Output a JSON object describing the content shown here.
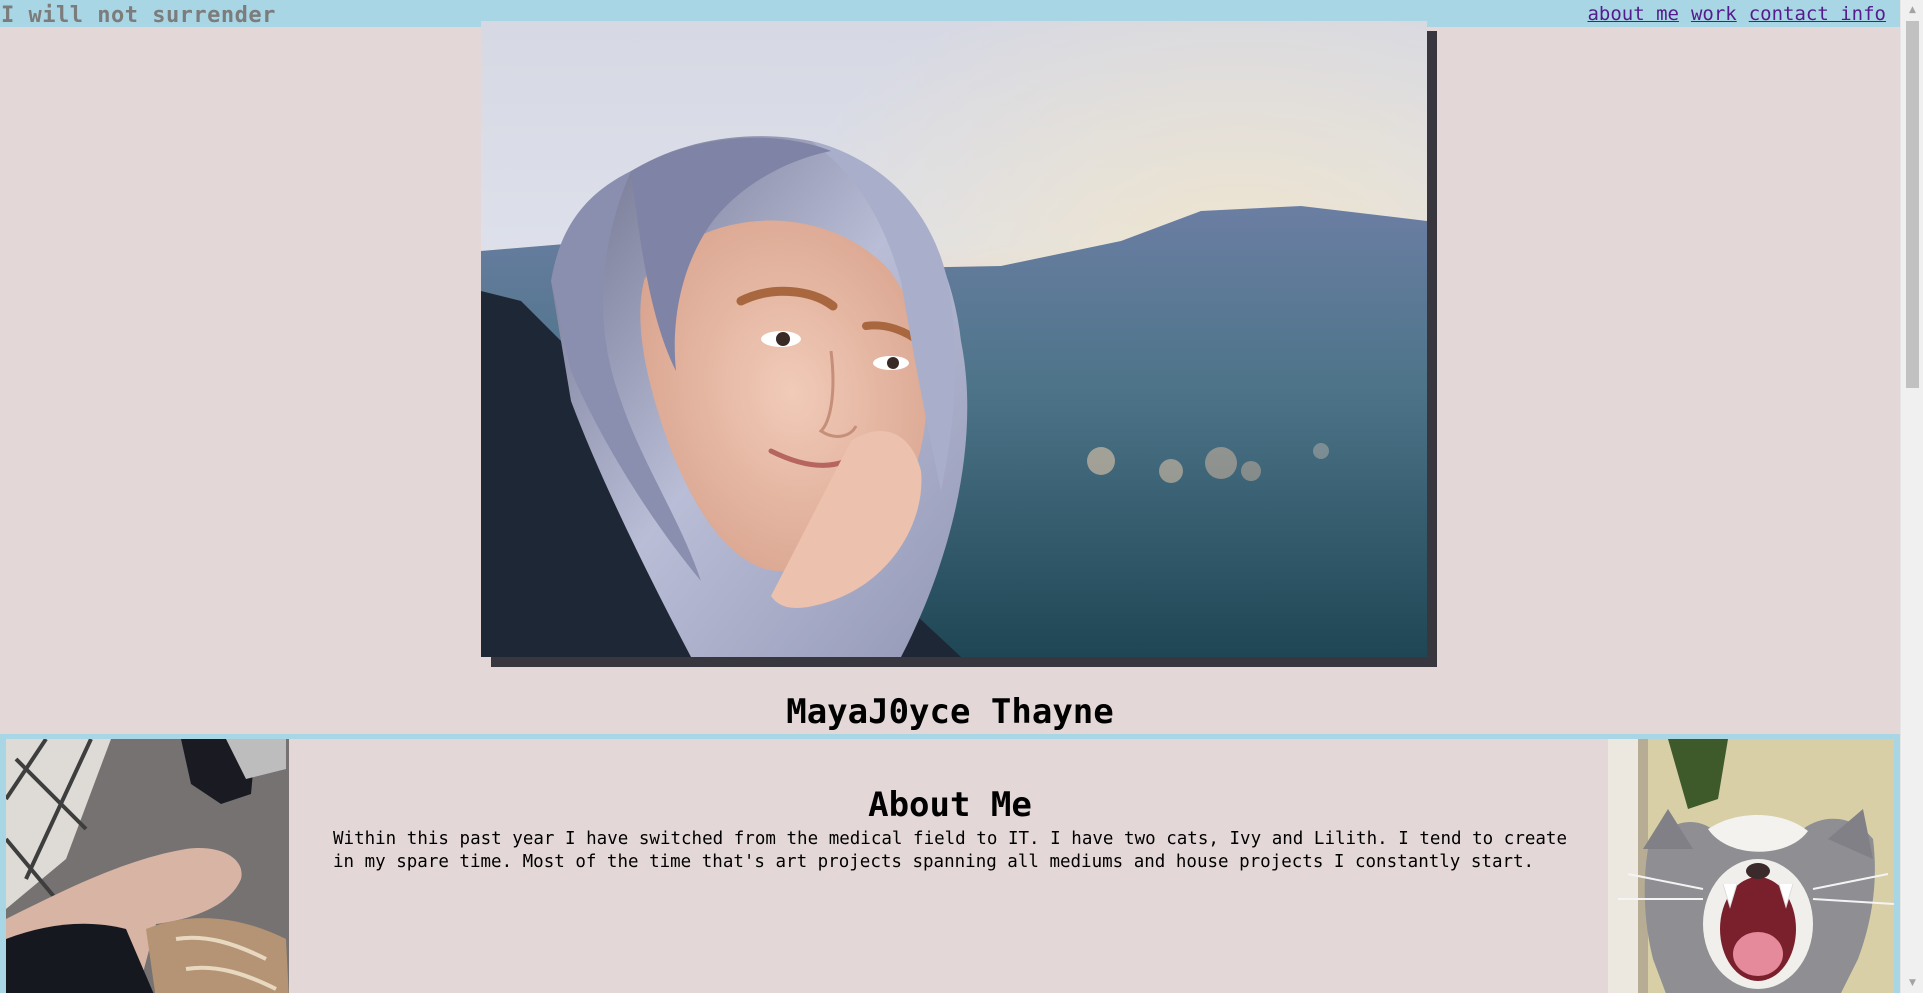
{
  "header": {
    "site_title": "I will not surrender",
    "nav": [
      {
        "label": "about me"
      },
      {
        "label": "work"
      },
      {
        "label": "contact info"
      }
    ]
  },
  "hero": {
    "name": "MayaJ0yce Thayne"
  },
  "about": {
    "title": "About Me",
    "text": "Within this past year I have switched from the medical field to IT. I have two cats, Ivy and Lilith. I tend to create in my spare time. Most of the time that's art projects spanning all mediums and house projects I constantly start."
  },
  "colors": {
    "background": "#e3d8d7",
    "accent": "#a9d6e5",
    "shadow": "#38363f",
    "link": "#0000ee",
    "visited_link": "#551a8b"
  }
}
